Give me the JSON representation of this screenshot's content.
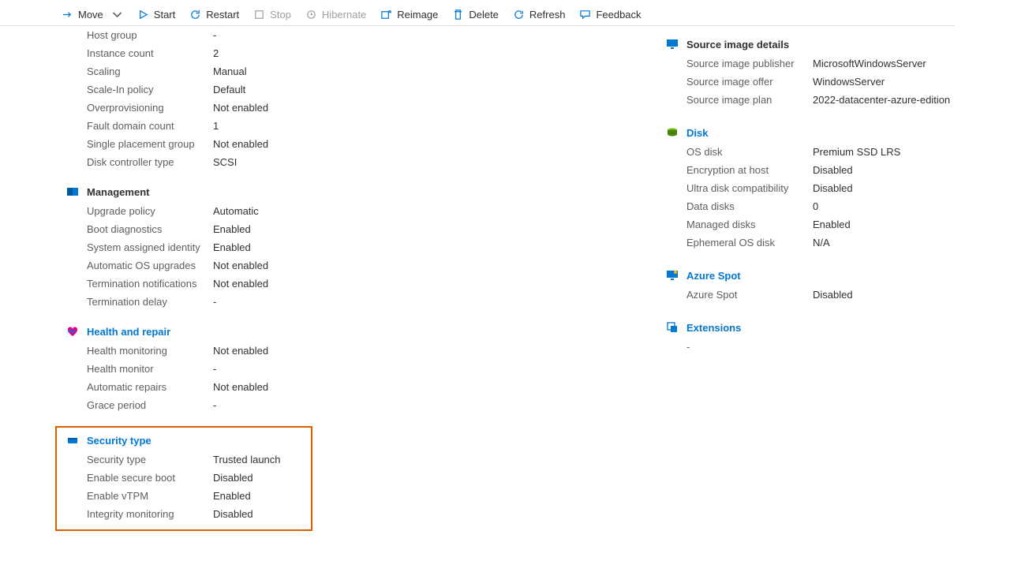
{
  "toolbar": {
    "move": "Move",
    "start": "Start",
    "restart": "Restart",
    "stop": "Stop",
    "hibernate": "Hibernate",
    "reimage": "Reimage",
    "delete": "Delete",
    "refresh": "Refresh",
    "feedback": "Feedback"
  },
  "left": {
    "top": {
      "host_group": {
        "l": "Host group",
        "v": "-"
      },
      "instance_count": {
        "l": "Instance count",
        "v": "2"
      },
      "scaling": {
        "l": "Scaling",
        "v": "Manual"
      },
      "scalein": {
        "l": "Scale-In policy",
        "v": "Default"
      },
      "overprov": {
        "l": "Overprovisioning",
        "v": "Not enabled"
      },
      "faultdomain": {
        "l": "Fault domain count",
        "v": "1"
      },
      "spg": {
        "l": "Single placement group",
        "v": "Not enabled"
      },
      "dct": {
        "l": "Disk controller type",
        "v": "SCSI"
      }
    },
    "management": {
      "title": "Management",
      "upgrade": {
        "l": "Upgrade policy",
        "v": "Automatic"
      },
      "bootdiag": {
        "l": "Boot diagnostics",
        "v": "Enabled"
      },
      "sysid": {
        "l": "System assigned identity",
        "v": "Enabled"
      },
      "autoos": {
        "l": "Automatic OS upgrades",
        "v": "Not enabled"
      },
      "termnotif": {
        "l": "Termination notifications",
        "v": "Not enabled"
      },
      "termdelay": {
        "l": "Termination delay",
        "v": "-"
      }
    },
    "health": {
      "title": "Health and repair",
      "monitoring": {
        "l": "Health monitoring",
        "v": "Not enabled"
      },
      "monitor": {
        "l": "Health monitor",
        "v": "-"
      },
      "repairs": {
        "l": "Automatic repairs",
        "v": "Not enabled"
      },
      "grace": {
        "l": "Grace period",
        "v": "-"
      }
    },
    "security": {
      "title": "Security type",
      "sectype": {
        "l": "Security type",
        "v": "Trusted launch"
      },
      "secureboot": {
        "l": "Enable secure boot",
        "v": "Disabled"
      },
      "vtpm": {
        "l": "Enable vTPM",
        "v": "Enabled"
      },
      "integrity": {
        "l": "Integrity monitoring",
        "v": "Disabled"
      }
    }
  },
  "right": {
    "image": {
      "title": "Source image details",
      "publisher": {
        "l": "Source image publisher",
        "v": "MicrosoftWindowsServer"
      },
      "offer": {
        "l": "Source image offer",
        "v": "WindowsServer"
      },
      "plan": {
        "l": "Source image plan",
        "v": "2022-datacenter-azure-edition"
      }
    },
    "disk": {
      "title": "Disk",
      "osdisk": {
        "l": "OS disk",
        "v": "Premium SSD LRS"
      },
      "enc": {
        "l": "Encryption at host",
        "v": "Disabled"
      },
      "ultra": {
        "l": "Ultra disk compatibility",
        "v": "Disabled"
      },
      "datadisks": {
        "l": "Data disks",
        "v": "0"
      },
      "managed": {
        "l": "Managed disks",
        "v": "Enabled"
      },
      "ephemeral": {
        "l": "Ephemeral OS disk",
        "v": "N/A"
      }
    },
    "spot": {
      "title": "Azure Spot",
      "spot": {
        "l": "Azure Spot",
        "v": "Disabled"
      }
    },
    "extensions": {
      "title": "Extensions",
      "placeholder": "-"
    }
  }
}
